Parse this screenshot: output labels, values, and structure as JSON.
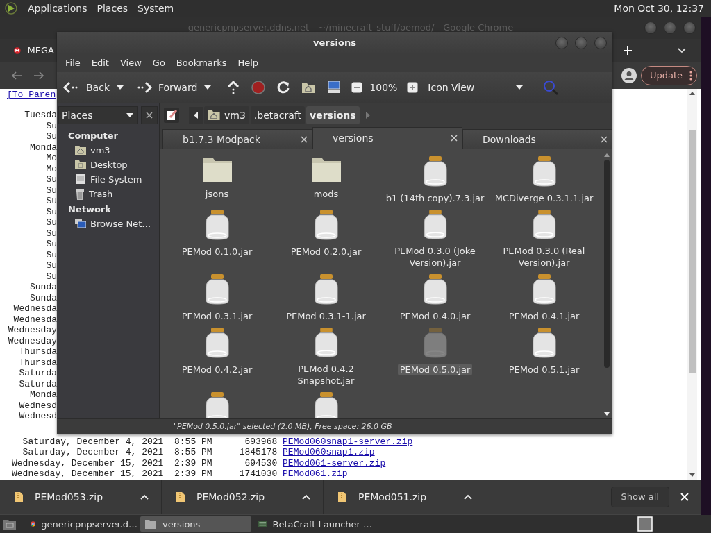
{
  "top_panel": {
    "menus": [
      "Applications",
      "Places",
      "System"
    ],
    "clock": "Mon Oct 30, 12:37"
  },
  "browser": {
    "title": "genericpnpserver.ddns.net - ~/minecraft_stuff/pemod/ - Google Chrome",
    "tab": "MEGA",
    "update_button": "Update",
    "listing": {
      "parent_link": "[To Paren",
      "fragments": [
        "Tuesda",
        "Su",
        "Su",
        "Monda",
        "Mo",
        "Mo",
        "Su",
        "Su",
        "Su",
        "Su",
        "Su",
        "Su",
        "Su",
        "Su",
        "Su",
        "Su",
        "Sunda",
        "Sunda",
        "Wednesda",
        "Wednesda",
        "Wednesday",
        "Wednesday",
        "Thursda",
        "Thursda",
        "Saturda",
        "Saturda",
        "Monda",
        "Wednesd",
        "Wednesd"
      ],
      "rows": [
        {
          "date": "Saturday, December 4, 2021",
          "time": "8:55 PM",
          "size": "693968",
          "file": "PEMod060snap1-server.zip"
        },
        {
          "date": "Saturday, December 4, 2021",
          "time": "8:55 PM",
          "size": "1845178",
          "file": "PEMod060snap1.zip"
        },
        {
          "date": "Wednesday, December 15, 2021",
          "time": "2:39 PM",
          "size": "694530",
          "file": "PEMod061-server.zip"
        },
        {
          "date": "Wednesday, December 15, 2021",
          "time": "2:39 PM",
          "size": "1741030",
          "file": "PEMod061.zip"
        }
      ]
    },
    "downloads": [
      "PEMod053.zip",
      "PEMod052.zip",
      "PEMod051.zip"
    ],
    "show_all": "Show all"
  },
  "file_manager": {
    "title": "versions",
    "menus": [
      "File",
      "Edit",
      "View",
      "Go",
      "Bookmarks",
      "Help"
    ],
    "toolbar": {
      "back": "Back",
      "forward": "Forward",
      "zoom": "100%",
      "view": "Icon View"
    },
    "sidebar": {
      "header": "Places",
      "sections": [
        {
          "title": "Computer",
          "items": [
            {
              "label": "vm3",
              "kind": "home"
            },
            {
              "label": "Desktop",
              "kind": "desktop"
            },
            {
              "label": "File System",
              "kind": "drive"
            },
            {
              "label": "Trash",
              "kind": "trash"
            }
          ]
        },
        {
          "title": "Network",
          "items": [
            {
              "label": "Browse Net…",
              "kind": "network"
            }
          ]
        }
      ]
    },
    "breadcrumbs": [
      {
        "label": "vm3",
        "kind": "home",
        "selected": false
      },
      {
        "label": ".betacraft",
        "kind": "plain",
        "selected": false
      },
      {
        "label": "versions",
        "kind": "plain",
        "selected": true
      }
    ],
    "tabs": [
      {
        "label": "b1.7.3 Modpack",
        "selected": false
      },
      {
        "label": "versions",
        "selected": true
      },
      {
        "label": "Downloads",
        "selected": false
      }
    ],
    "files": [
      {
        "name": "jsons",
        "kind": "folder",
        "selected": false
      },
      {
        "name": "mods",
        "kind": "folder",
        "selected": false
      },
      {
        "name": "b1 (14th copy).7.3.jar",
        "kind": "jar",
        "selected": false
      },
      {
        "name": "MCDiverge 0.3.1.1.jar",
        "kind": "jar",
        "selected": false
      },
      {
        "name": "PEMod 0.1.0.jar",
        "kind": "jar",
        "selected": false
      },
      {
        "name": "PEMod 0.2.0.jar",
        "kind": "jar",
        "selected": false
      },
      {
        "name": "PEMod 0.3.0 (Joke Version).jar",
        "kind": "jar",
        "selected": false
      },
      {
        "name": "PEMod 0.3.0 (Real Version).jar",
        "kind": "jar",
        "selected": false
      },
      {
        "name": "PEMod 0.3.1.jar",
        "kind": "jar",
        "selected": false
      },
      {
        "name": "PEMod 0.3.1-1.jar",
        "kind": "jar",
        "selected": false
      },
      {
        "name": "PEMod 0.4.0.jar",
        "kind": "jar",
        "selected": false
      },
      {
        "name": "PEMod 0.4.1.jar",
        "kind": "jar",
        "selected": false
      },
      {
        "name": "PEMod 0.4.2.jar",
        "kind": "jar",
        "selected": false
      },
      {
        "name": "PEMod 0.4.2 Snapshot.jar",
        "kind": "jar",
        "selected": false
      },
      {
        "name": "PEMod 0.5.0.jar",
        "kind": "jar",
        "selected": true
      },
      {
        "name": "PEMod 0.5.1.jar",
        "kind": "jar",
        "selected": false
      },
      {
        "kind": "jar",
        "selected": false
      },
      {
        "kind": "jar",
        "selected": false
      }
    ],
    "status": "\"PEMod 0.5.0.jar\" selected (2.0 MB), Free space: 26.0 GB"
  },
  "taskbar": [
    {
      "label": "genericpnpserver.d…",
      "kind": "browser",
      "selected": false
    },
    {
      "label": "versions",
      "kind": "folder",
      "selected": true
    },
    {
      "label": "BetaCraft Launcher …",
      "kind": "launcher",
      "selected": false
    }
  ]
}
